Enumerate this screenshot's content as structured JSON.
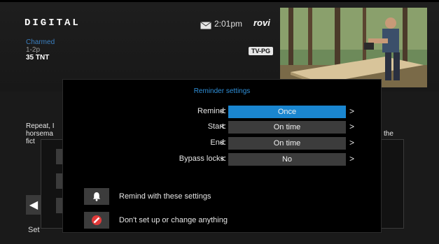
{
  "header": {
    "logo": "DIGITAL",
    "clock": "2:01pm",
    "brand": "rovi",
    "icons": {
      "mail": "mail-icon"
    }
  },
  "program": {
    "title": "Charmed",
    "time": "1-2p",
    "channel": "35 TNT",
    "rating": "TV-PG"
  },
  "background": {
    "description_lines": [
      "Repeat, I",
      "horsema",
      "fict"
    ],
    "description_right": "the",
    "set_label": "Set"
  },
  "modal": {
    "title": "Reminder settings",
    "rows": [
      {
        "label": "Remind:",
        "value": "Once",
        "selected": true
      },
      {
        "label": "Start:",
        "value": "On time",
        "selected": false
      },
      {
        "label": "End:",
        "value": "On time",
        "selected": false
      },
      {
        "label": "Bypass locks:",
        "value": "No",
        "selected": false
      }
    ],
    "arrow_left": "<",
    "arrow_right": ">",
    "actions": [
      {
        "label": "Remind with these settings",
        "icon": "bell-icon"
      },
      {
        "label": "Don't set up or change anything",
        "icon": "cancel-icon"
      }
    ]
  },
  "colors": {
    "accent": "#1a86d0",
    "title": "#2f8fd8",
    "panel": "#3c3c3c",
    "cancel": "#e23a3a"
  }
}
